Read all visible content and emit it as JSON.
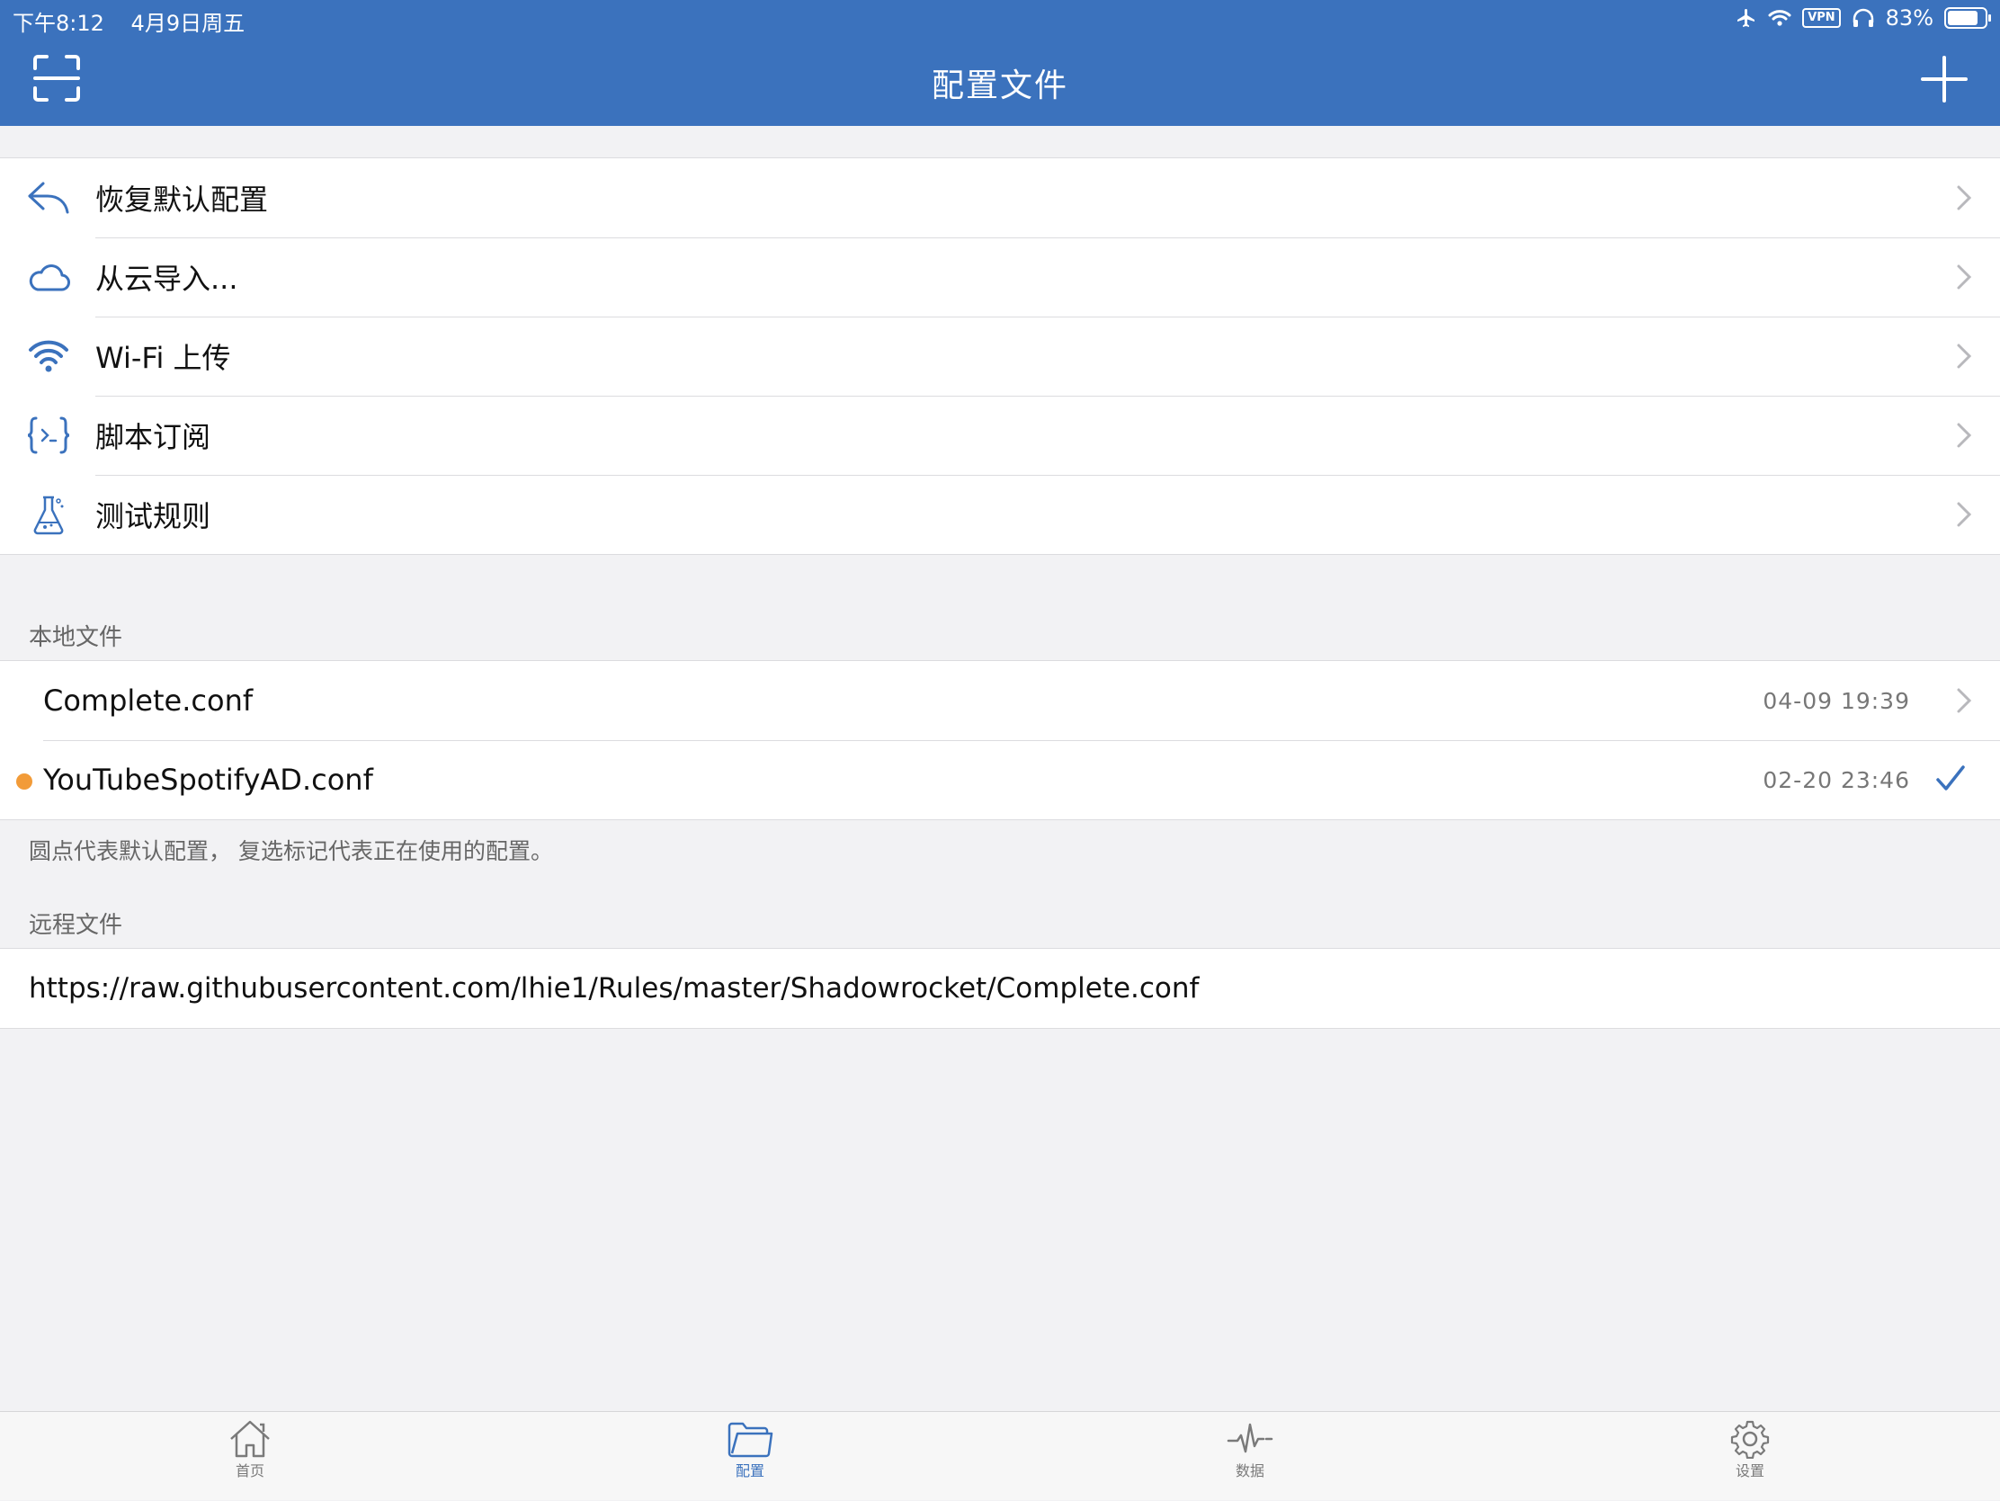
{
  "status_bar": {
    "time": "下午8:12",
    "date": "4月9日周五",
    "vpn": "VPN",
    "battery": "83%",
    "battery_level": 0.83
  },
  "nav": {
    "title": "配置文件",
    "left_icon": "scan-icon",
    "right_icon": "plus-icon"
  },
  "actions": [
    {
      "label": "恢复默认配置",
      "icon": "reply-arrow-icon"
    },
    {
      "label": "从云导入...",
      "icon": "cloud-icon"
    },
    {
      "label": "Wi-Fi 上传",
      "icon": "wifi-icon"
    },
    {
      "label": "脚本订阅",
      "icon": "script-braces-icon"
    },
    {
      "label": "测试规则",
      "icon": "flask-icon"
    }
  ],
  "local_files": {
    "header": "本地文件",
    "items": [
      {
        "name": "Complete.conf",
        "date": "04-09 19:39",
        "is_default": false,
        "in_use": false
      },
      {
        "name": "YouTubeSpotifyAD.conf",
        "date": "02-20 23:46",
        "is_default": true,
        "in_use": true
      }
    ],
    "footnote": "圆点代表默认配置， 复选标记代表正在使用的配置。"
  },
  "remote_files": {
    "header": "远程文件",
    "items": [
      {
        "url": "https://raw.githubusercontent.com/lhie1/Rules/master/Shadowrocket/Complete.conf"
      }
    ]
  },
  "tabs": [
    {
      "label": "首页",
      "icon": "home-icon",
      "active": false
    },
    {
      "label": "配置",
      "icon": "folder-icon",
      "active": true
    },
    {
      "label": "数据",
      "icon": "activity-icon",
      "active": false
    },
    {
      "label": "设置",
      "icon": "gear-icon",
      "active": false
    }
  ],
  "colors": {
    "accent": "#3b72bd",
    "default_dot": "#f29b38",
    "background": "#f2f2f4"
  }
}
